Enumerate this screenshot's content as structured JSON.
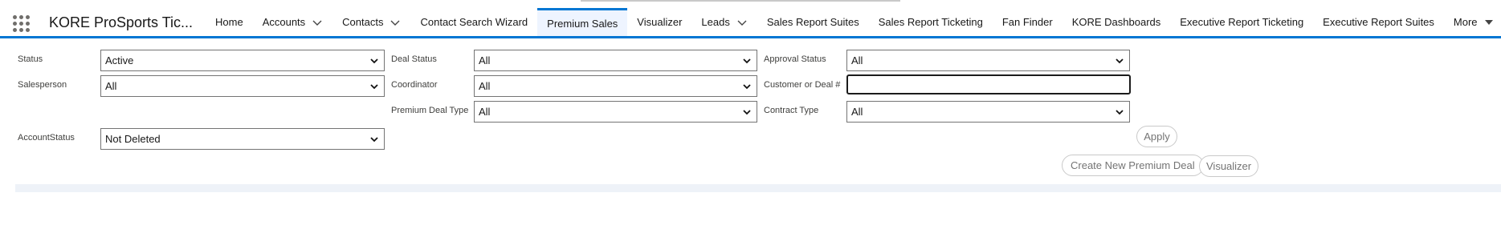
{
  "app": {
    "name": "KORE ProSports Tic..."
  },
  "nav": {
    "items": [
      {
        "label": "Home"
      },
      {
        "label": "Accounts"
      },
      {
        "label": "Contacts"
      },
      {
        "label": "Contact Search Wizard"
      },
      {
        "label": "Premium Sales",
        "active": true
      },
      {
        "label": "Visualizer"
      },
      {
        "label": "Leads"
      },
      {
        "label": "Sales Report Suites"
      },
      {
        "label": "Sales Report Ticketing"
      },
      {
        "label": "Fan Finder"
      },
      {
        "label": "KORE Dashboards"
      },
      {
        "label": "Executive Report Ticketing"
      },
      {
        "label": "Executive Report Suites"
      },
      {
        "label": "More"
      }
    ]
  },
  "filters": {
    "status": {
      "label": "Status",
      "value": "Active"
    },
    "salesperson": {
      "label": "Salesperson",
      "value": "All"
    },
    "account_status": {
      "label": "AccountStatus",
      "value": "Not Deleted"
    },
    "deal_status": {
      "label": "Deal Status",
      "value": "All"
    },
    "coordinator": {
      "label": "Coordinator",
      "value": "All"
    },
    "premium_deal_type": {
      "label": "Premium Deal Type",
      "value": "All"
    },
    "approval_status": {
      "label": "Approval Status",
      "value": "All"
    },
    "customer_or_deal": {
      "label": "Customer or Deal #",
      "value": "",
      "placeholder": ""
    },
    "contract_type": {
      "label": "Contract Type",
      "value": "All"
    }
  },
  "actions": {
    "apply": "Apply",
    "create_new_premium_deal": "Create New Premium Deal",
    "visualizer": "Visualizer"
  },
  "colors": {
    "brand": "#0176d3",
    "active_tab_bg": "#eef4ff"
  }
}
